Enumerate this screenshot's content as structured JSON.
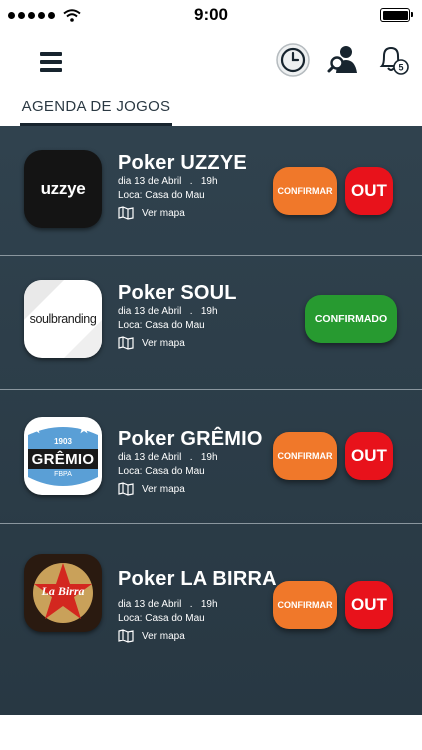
{
  "status_bar": {
    "time": "9:00"
  },
  "header": {
    "menu_icon": "hamburger-menu-icon",
    "icons": [
      "clock-icon",
      "user-search-icon",
      "bell-icon"
    ],
    "notification_count": "5"
  },
  "tabs": [
    {
      "label": "AGENDA DE JOGOS",
      "active": true
    }
  ],
  "games": [
    {
      "title": "Poker UZZYE",
      "date": "dia 13 de Abril",
      "sep": ".",
      "hour": "19h",
      "location": "Loca: Casa do Mau",
      "map_label": "Ver mapa",
      "logo_text": "uzzye",
      "confirm_label": "CONFIRMAR",
      "out_label": "OUT"
    },
    {
      "title": "Poker SOUL",
      "date": "dia 13 de Abril",
      "sep": ".",
      "hour": "19h",
      "location": "Loca: Casa do Mau",
      "map_label": "Ver mapa",
      "logo_text": "soulbranding",
      "confirmed_label": "CONFIRMADO"
    },
    {
      "title": "Poker GRÊMIO",
      "date": "dia 13 de Abril",
      "sep": ".",
      "hour": "19h",
      "location": "Loca: Casa do Mau",
      "map_label": "Ver mapa",
      "logo_text": "GRÊMIO",
      "logo_year": "1903",
      "logo_sub": "FBPA",
      "confirm_label": "CONFIRMAR",
      "out_label": "OUT"
    },
    {
      "title": "Poker LA BIRRA",
      "date": "dia 13 de Abril",
      "sep": ".",
      "hour": "19h",
      "location": "Loca: Casa do Mau",
      "map_label": "Ver mapa",
      "logo_text": "La Birra",
      "confirm_label": "CONFIRMAR",
      "out_label": "OUT"
    }
  ],
  "colors": {
    "list_bg": "#2c3e49",
    "confirm": "#f0782a",
    "out": "#e8121b",
    "confirmed": "#279a30"
  }
}
